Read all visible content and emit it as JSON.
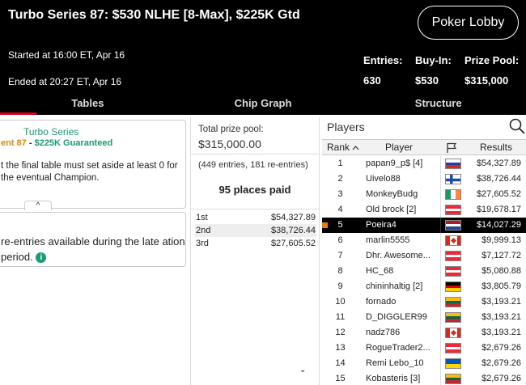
{
  "header": {
    "title": "Turbo Series 87: $530 NLHE [8-Max], $225K Gtd",
    "started": "Started at 16:00 ET, Apr 16",
    "ended": "Ended at 20:27 ET, Apr 16",
    "lobby_button": "Poker Lobby",
    "stats": {
      "entries_label": "Entries:",
      "entries_value": "630",
      "buyin_label": "Buy-In:",
      "buyin_value": "$530",
      "prize_label": "Prize Pool:",
      "prize_value": "$315,000"
    }
  },
  "tabs": [
    "Tables",
    "Chip Graph",
    "Structure"
  ],
  "info_card": {
    "series": "Turbo Series",
    "event": "ent 87",
    "separator": " - ",
    "guarantee": "$225K Guaranteed",
    "text": "t the final table must set aside at least 0 for the eventual Champion.",
    "collapse": "^"
  },
  "reentry_card": {
    "text": "re-entries available during the late ation period.",
    "info_icon": "i"
  },
  "prize_panel": {
    "label": "Total prize pool:",
    "value": "$315,000.00",
    "entries": "(449 entries, 181 re-entries)",
    "places": "95 places paid",
    "payouts": [
      {
        "place": "1st",
        "amount": "$54,327.89"
      },
      {
        "place": "2nd",
        "amount": "$38,726.44"
      },
      {
        "place": "3rd",
        "amount": "$27,605.52"
      }
    ],
    "more": "⌄"
  },
  "players": {
    "title": "Players",
    "columns": {
      "rank": "Rank",
      "player": "Player",
      "results": "Results"
    },
    "rows": [
      {
        "rank": "1",
        "name": "papan9_p$ [4]",
        "flag": "russia",
        "result": "$54,327.89"
      },
      {
        "rank": "2",
        "name": "Uivelo88",
        "flag": "finland",
        "result": "$38,726.44"
      },
      {
        "rank": "3",
        "name": "MonkeyBudg",
        "flag": "ireland",
        "result": "$27,605.52"
      },
      {
        "rank": "4",
        "name": "Old brock [2]",
        "flag": "austria",
        "result": "$19,678.17"
      },
      {
        "rank": "5",
        "name": "Poeira4",
        "flag": "netherlands",
        "result": "$14,027.29",
        "highlight": true
      },
      {
        "rank": "6",
        "name": "marlin5555",
        "flag": "canada",
        "result": "$9,999.13"
      },
      {
        "rank": "7",
        "name": "Dhr. Awesome...",
        "flag": "austria",
        "result": "$7,127.72"
      },
      {
        "rank": "8",
        "name": "HC_68",
        "flag": "austria",
        "result": "$5,080.88"
      },
      {
        "rank": "9",
        "name": "chininhaltig [2]",
        "flag": "germany",
        "result": "$3,805.79"
      },
      {
        "rank": "10",
        "name": "fornado",
        "flag": "lithuania",
        "result": "$3,193.21"
      },
      {
        "rank": "11",
        "name": "D_DIGGLER99",
        "flag": "lithuania",
        "result": "$3,193.21"
      },
      {
        "rank": "12",
        "name": "nadz786",
        "flag": "canada",
        "result": "$3,193.21"
      },
      {
        "rank": "13",
        "name": "RogueTrader2...",
        "flag": "austria",
        "result": "$2,679.26"
      },
      {
        "rank": "14",
        "name": "Remi Lebo_10",
        "flag": "ukraine",
        "result": "$2,679.26"
      },
      {
        "rank": "15",
        "name": "Kobasteris [3]",
        "flag": "lithuania",
        "result": "$2,679.26"
      }
    ]
  },
  "colors": {
    "accent_red": "#d0021b",
    "green": "#1a9b73",
    "orange": "#e08a00"
  }
}
